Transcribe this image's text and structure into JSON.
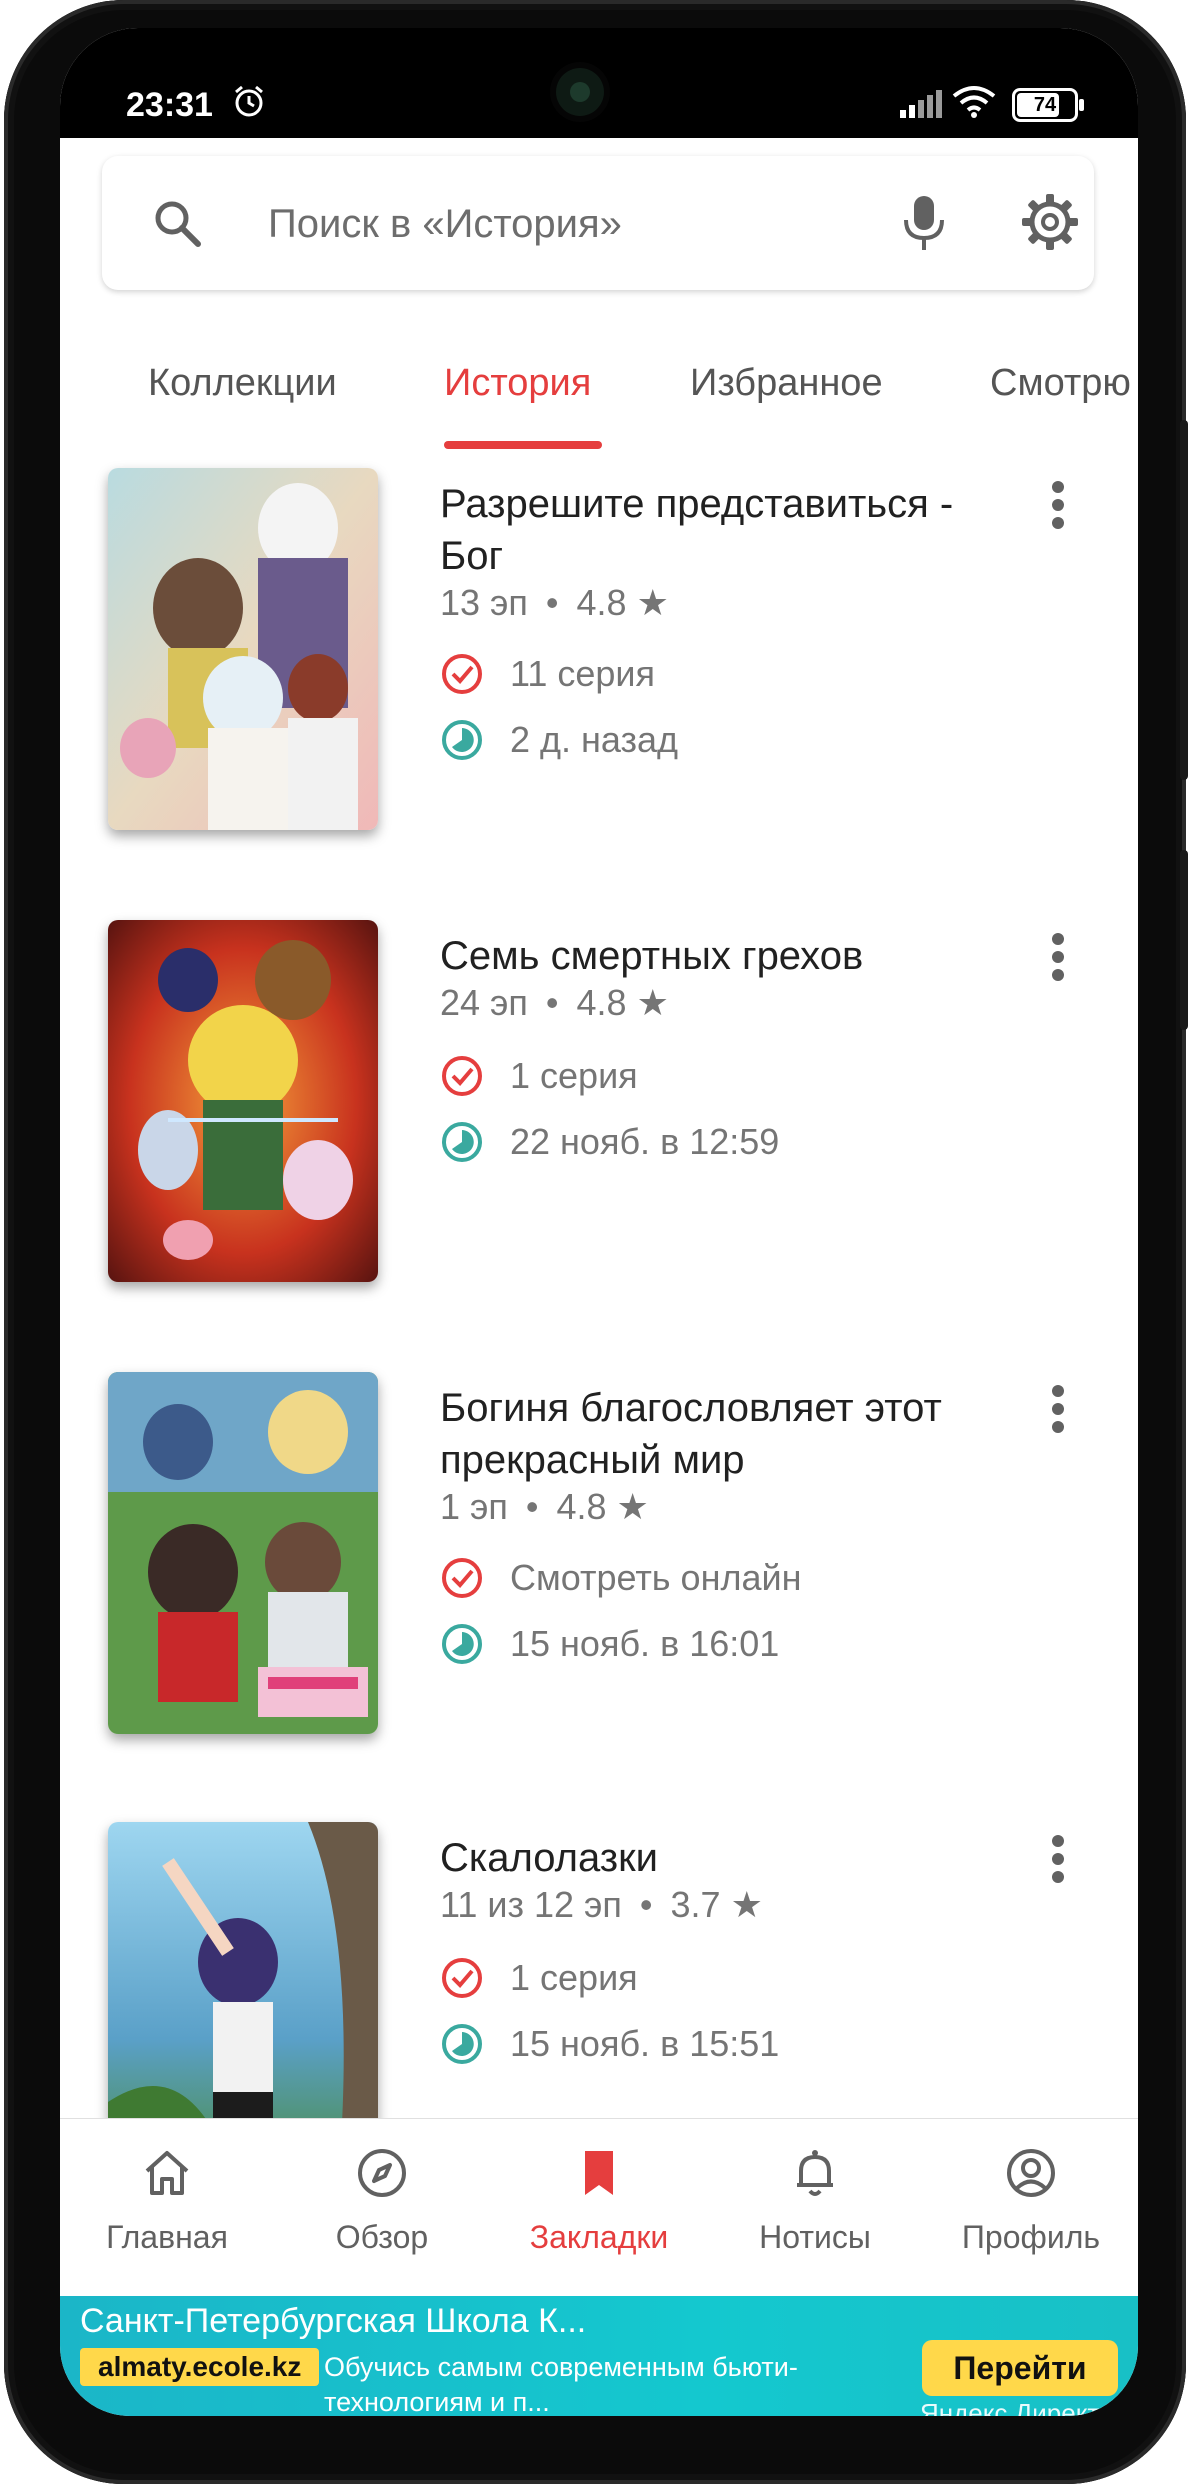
{
  "status_bar": {
    "time": "23:31",
    "battery": "74"
  },
  "search": {
    "placeholder": "Поиск в «История»"
  },
  "tabs": [
    {
      "label": "Коллекции",
      "active": false
    },
    {
      "label": "История",
      "active": true
    },
    {
      "label": "Избранное",
      "active": false
    },
    {
      "label": "Смотрю",
      "active": false
    }
  ],
  "items": [
    {
      "title": "Разрешите представиться - Бог",
      "episodes": "13 эп",
      "rating": "4.8 ★",
      "watched": "11 серия",
      "time": "2 д. назад"
    },
    {
      "title": "Семь смертных грехов",
      "episodes": "24 эп",
      "rating": "4.8 ★",
      "watched": "1 серия",
      "time": "22 нояб. в 12:59"
    },
    {
      "title": "Богиня благословляет этот прекрасный мир",
      "episodes": "1 эп",
      "rating": "4.8 ★",
      "watched": "Смотреть онлайн",
      "time": "15 нояб. в 16:01"
    },
    {
      "title": "Скалолазки",
      "episodes": "11 из 12 эп",
      "rating": "3.7 ★",
      "watched": "1 серия",
      "time": "15 нояб. в 15:51"
    }
  ],
  "bottom_nav": [
    {
      "label": "Главная",
      "icon": "home-icon",
      "active": false
    },
    {
      "label": "Обзор",
      "icon": "compass-icon",
      "active": false
    },
    {
      "label": "Закладки",
      "icon": "bookmark-icon",
      "active": true
    },
    {
      "label": "Нотисы",
      "icon": "bell-icon",
      "active": false
    },
    {
      "label": "Профиль",
      "icon": "profile-icon",
      "active": false
    }
  ],
  "ad": {
    "title": "Санкт-Петербургская Школа К...",
    "domain": "almaty.ecole.kz",
    "text": "Обучись самым современным бьюти-технологиям и п...",
    "button": "Перейти",
    "source": "Яндекс.Директ"
  },
  "colors": {
    "accent": "#e53e3e",
    "teal": "#3aa99f",
    "ad_bg": "#14c8cf",
    "ad_button": "#ffd84a"
  }
}
